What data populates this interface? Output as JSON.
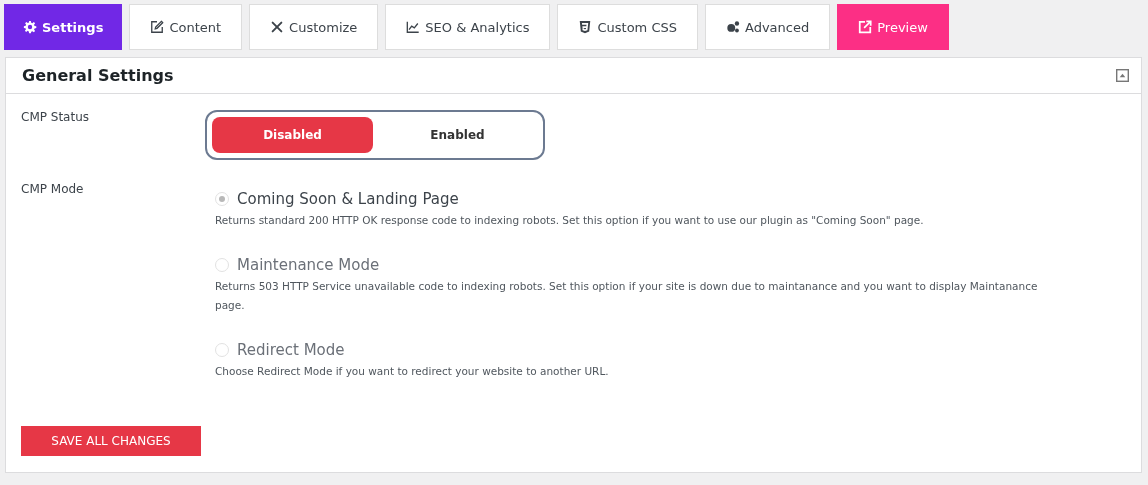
{
  "tabs": [
    {
      "label": "Settings",
      "selected": true,
      "kind": "settings"
    },
    {
      "label": "Content",
      "selected": false,
      "kind": "tab"
    },
    {
      "label": "Customize",
      "selected": false,
      "kind": "tab"
    },
    {
      "label": "SEO & Analytics",
      "selected": false,
      "kind": "tab"
    },
    {
      "label": "Custom CSS",
      "selected": false,
      "kind": "tab"
    },
    {
      "label": "Advanced",
      "selected": false,
      "kind": "tab"
    },
    {
      "label": "Preview",
      "selected": false,
      "kind": "preview"
    }
  ],
  "panel": {
    "title": "General Settings",
    "expanded": true
  },
  "status": {
    "label": "CMP Status",
    "options": [
      {
        "label": "Disabled",
        "selected": true
      },
      {
        "label": "Enabled",
        "selected": false
      }
    ]
  },
  "mode": {
    "label": "CMP Mode",
    "options": [
      {
        "label": "Coming Soon & Landing Page",
        "selected": true,
        "description": "Returns standard 200 HTTP OK response code to indexing robots. Set this option if you want to use our plugin as \"Coming Soon\" page."
      },
      {
        "label": "Maintenance Mode",
        "selected": false,
        "description": "Returns 503 HTTP Service unavailable code to indexing robots. Set this option if your site is down due to maintanance and you want to display Maintanance page."
      },
      {
        "label": "Redirect Mode",
        "selected": false,
        "description": "Choose Redirect Mode if you want to redirect your website to another URL."
      }
    ]
  },
  "save_button": "SAVE ALL CHANGES"
}
